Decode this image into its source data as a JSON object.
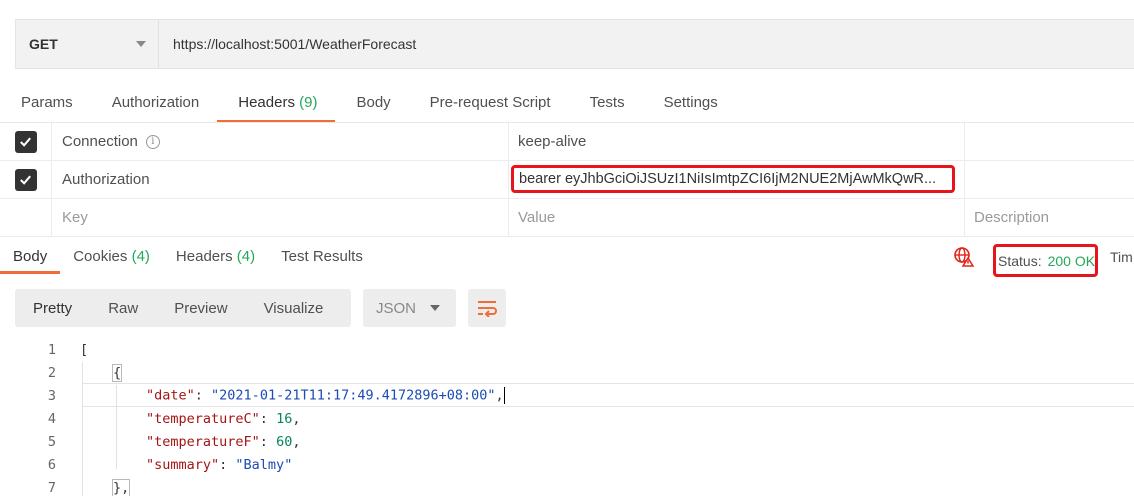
{
  "request": {
    "method": "GET",
    "url": "https://localhost:5001/WeatherForecast"
  },
  "request_tabs": [
    {
      "label": "Params",
      "count": ""
    },
    {
      "label": "Authorization",
      "count": ""
    },
    {
      "label": "Headers",
      "count": "(9)"
    },
    {
      "label": "Body",
      "count": ""
    },
    {
      "label": "Pre-request Script",
      "count": ""
    },
    {
      "label": "Tests",
      "count": ""
    },
    {
      "label": "Settings",
      "count": ""
    }
  ],
  "headers_table": {
    "rows": [
      {
        "key": "Connection",
        "value": "keep-alive",
        "checked": true,
        "info": "ⓘ"
      },
      {
        "key": "Authorization",
        "value": "bearer eyJhbGciOiJSUzI1NiIsImtpZCI6IjM2NUE2MjAwMkQwR...",
        "checked": true
      }
    ],
    "placeholders": {
      "key": "Key",
      "value": "Value",
      "description": "Description"
    }
  },
  "response_tabs": [
    {
      "label": "Body",
      "count": ""
    },
    {
      "label": "Cookies",
      "count": "(4)"
    },
    {
      "label": "Headers",
      "count": "(4)"
    },
    {
      "label": "Test Results",
      "count": ""
    }
  ],
  "status": {
    "label": "Status:",
    "value": "200 OK",
    "time_label": "Tim"
  },
  "view_buttons": [
    "Pretty",
    "Raw",
    "Preview",
    "Visualize"
  ],
  "format": "JSON",
  "code_lines": [
    {
      "n": "1",
      "text": "["
    },
    {
      "n": "2",
      "text": "{"
    },
    {
      "n": "3",
      "key": "\"date\"",
      "value": "\"2021-01-21T11:17:49.4172896+08:00\"",
      "type": "s",
      "comma": ","
    },
    {
      "n": "4",
      "key": "\"temperatureC\"",
      "value": "16",
      "type": "n",
      "comma": ","
    },
    {
      "n": "5",
      "key": "\"temperatureF\"",
      "value": "60",
      "type": "n",
      "comma": ","
    },
    {
      "n": "6",
      "key": "\"summary\"",
      "value": "\"Balmy\"",
      "type": "s",
      "comma": ""
    },
    {
      "n": "7",
      "text": "},"
    }
  ],
  "colors": {
    "accent": "#f26b3a",
    "success": "#26a65b",
    "highlight": "#e8141b"
  }
}
